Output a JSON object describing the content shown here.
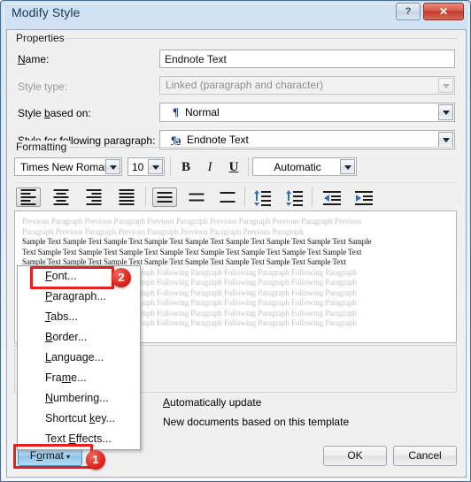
{
  "window": {
    "title": "Modify Style",
    "help_icon": "question-mark-icon",
    "close_icon": "close-x-icon",
    "help_label": "?",
    "close_label": "✕"
  },
  "properties": {
    "group_label": "Properties",
    "name_label": "Name:",
    "name_value": "Endnote Text",
    "style_type_label": "Style type:",
    "style_type_value": "Linked (paragraph and character)",
    "style_based_on_label": "Style based on:",
    "style_based_on_icon": "pilcrow-icon",
    "style_based_on_value": "Normal",
    "style_following_label": "Style for following paragraph:",
    "style_following_icon": "linked-style-icon",
    "style_following_value": "Endnote Text"
  },
  "formatting": {
    "group_label": "Formatting",
    "font_family": "Times New Roman",
    "font_size": "10",
    "bold_label": "B",
    "italic_label": "I",
    "underline_label": "U",
    "font_color": "Automatic",
    "align_buttons": [
      {
        "name": "align-left-button",
        "pressed": true
      },
      {
        "name": "align-center-button",
        "pressed": false
      },
      {
        "name": "align-right-button",
        "pressed": false
      },
      {
        "name": "align-justify-button",
        "pressed": false
      }
    ],
    "linespacing_buttons": [
      {
        "name": "line-spacing-single-button",
        "pressed": true
      },
      {
        "name": "line-spacing-1-5-button",
        "pressed": false
      },
      {
        "name": "line-spacing-double-button",
        "pressed": false
      }
    ],
    "paragraph_space_buttons": [
      {
        "name": "decrease-paragraph-spacing-button",
        "pressed": false
      },
      {
        "name": "increase-paragraph-spacing-button",
        "pressed": false
      }
    ],
    "indent_buttons": [
      {
        "name": "decrease-indent-button",
        "pressed": false
      },
      {
        "name": "increase-indent-button",
        "pressed": false
      }
    ]
  },
  "preview": {
    "previous_paragraph_line1": "Previous Paragraph Previous Paragraph Previous Paragraph Previous Paragraph Previous Paragraph Previous",
    "previous_paragraph_line2": "Paragraph Previous Paragraph Previous Paragraph Previous Paragraph Previous Paragraph",
    "sample_line1": "Sample Text Sample Text Sample Text Sample Text Sample Text Sample Text Sample Text Sample Text Sample",
    "sample_line2": "Text Sample Text Sample Text Sample Text Sample Text Sample Text Sample Text Sample Text Sample Text",
    "sample_line3": "Sample Text Sample Text Sample Text Sample Text Sample Text Sample Text Sample Text Sample Text",
    "following_line1": "Following Paragraph Following Paragraph Following Paragraph Following Paragraph Following Paragraph",
    "following_line2": "Following Paragraph Following Paragraph Following Paragraph Following Paragraph Following Paragraph",
    "following_line3": "Following Paragraph Following Paragraph Following Paragraph Following Paragraph Following Paragraph",
    "following_line4": "Following Paragraph Following Paragraph Following Paragraph Following Paragraph Following Paragraph",
    "following_line5": "Following Paragraph Following Paragraph Following Paragraph Following Paragraph Following Paragraph",
    "following_line6": "Following Paragraph Following Paragraph Following Paragraph Following Paragraph Following Paragraph"
  },
  "options": {
    "automatically_update": "Automatically update",
    "new_documents_based_on_template": "New documents based on this template"
  },
  "context_menu": {
    "items": [
      {
        "label": "Font...",
        "name": "menu-item-font",
        "accel_index": 0
      },
      {
        "label": "Paragraph...",
        "name": "menu-item-paragraph",
        "accel_index": 0
      },
      {
        "label": "Tabs...",
        "name": "menu-item-tabs",
        "accel_index": 0
      },
      {
        "label": "Border...",
        "name": "menu-item-border",
        "accel_index": 0
      },
      {
        "label": "Language...",
        "name": "menu-item-language",
        "accel_index": 0
      },
      {
        "label": "Frame...",
        "name": "menu-item-frame",
        "accel_index": 3
      },
      {
        "label": "Numbering...",
        "name": "menu-item-numbering",
        "accel_index": 0
      },
      {
        "label": "Shortcut key...",
        "name": "menu-item-shortcut-key",
        "accel_index": 9
      },
      {
        "label": "Text Effects...",
        "name": "menu-item-text-effects",
        "accel_index": 5
      }
    ]
  },
  "footer": {
    "format_label": "Format",
    "format_caret": "▾",
    "ok_label": "OK",
    "cancel_label": "Cancel"
  },
  "annotations": {
    "step1": "1",
    "step2": "2",
    "accent_color": "#e62020"
  }
}
